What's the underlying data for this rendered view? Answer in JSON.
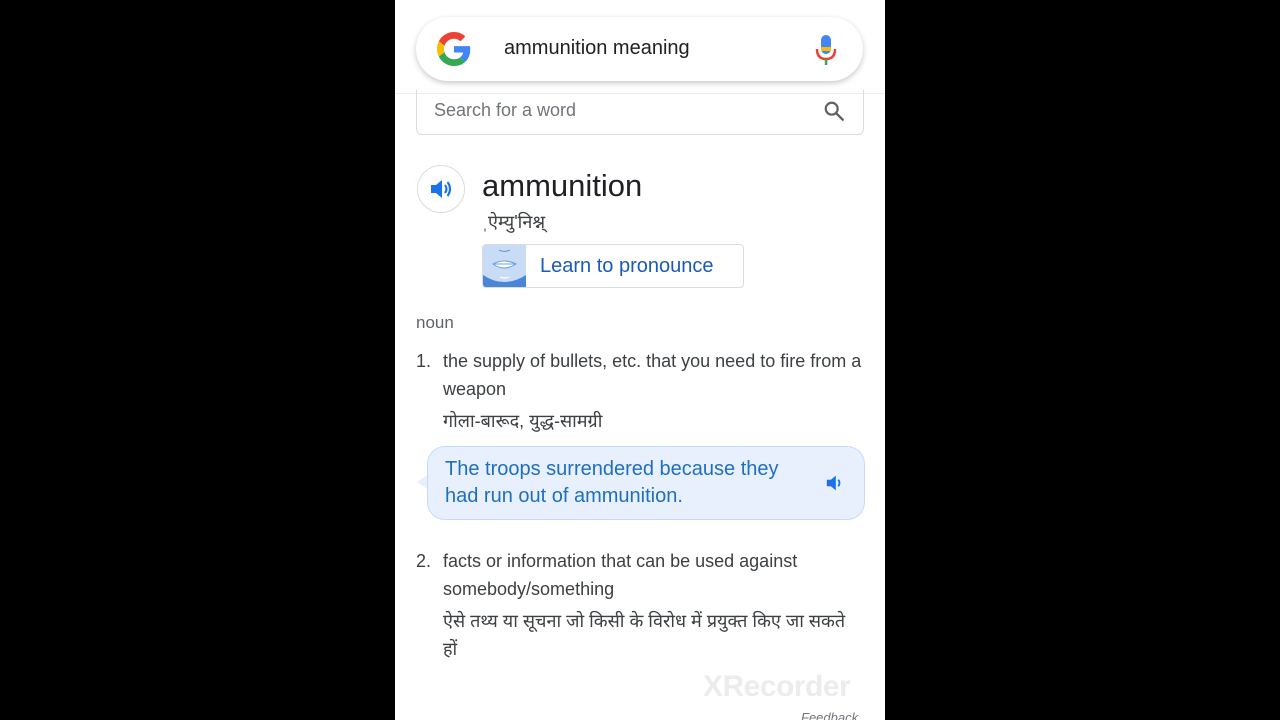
{
  "search": {
    "query": "ammunition meaning"
  },
  "dictionary": {
    "word_search_placeholder": "Search for a word",
    "headword": "ammunition",
    "phonetic": "ˌऐम्यु'निश्न्",
    "learn_to_pronounce": "Learn to pronounce",
    "part_of_speech": "noun",
    "senses": [
      {
        "number": "1.",
        "definition": "the supply of bullets, etc. that you need to fire from a weapon",
        "hindi": "गोला-बारूद, युद्ध-सामग्री",
        "example": "The troops surrendered because they had run out of ammunition."
      },
      {
        "number": "2.",
        "definition": "facts or information that can be used against somebody/something",
        "hindi": "ऐसे तथ्य या सूचना जो किसी के विरोध में प्रयुक्त किए जा सकते हों"
      }
    ]
  },
  "footer": {
    "watermark": "XRecorder",
    "feedback": "Feedback"
  },
  "colors": {
    "accent_blue": "#1a73e8",
    "example_bg": "#e8f0fe"
  },
  "icons": [
    "google-logo-icon",
    "mic-icon",
    "search-icon",
    "speaker-icon",
    "lips-icon"
  ]
}
